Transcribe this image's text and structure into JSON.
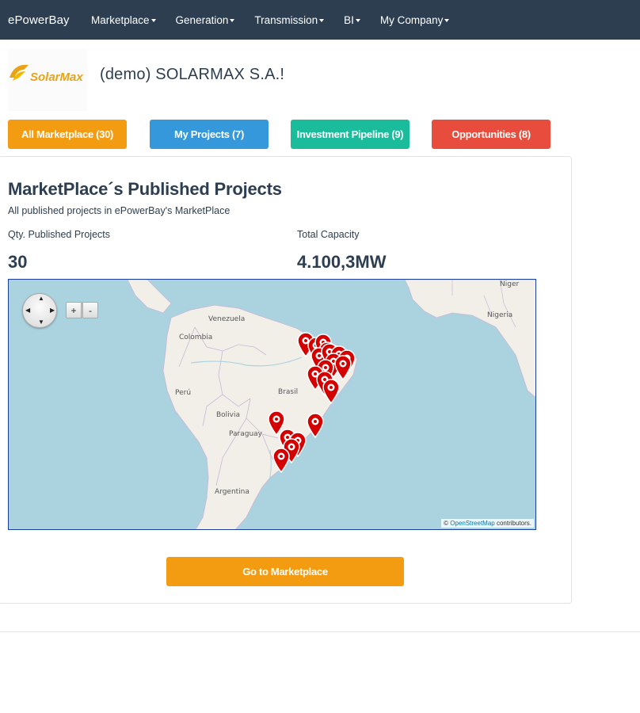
{
  "navbar": {
    "brand": "ePowerBay",
    "items": [
      "Marketplace",
      "Generation",
      "Transmission",
      "BI",
      "My Company"
    ]
  },
  "company": {
    "logo_text": "SolarMax",
    "name": "(demo) SOLARMAX S.A.!"
  },
  "filters": {
    "all": "All Marketplace (30)",
    "mine": "My Projects (7)",
    "pipeline": "Investment Pipeline (9)",
    "opportunities": "Opportunities (8)"
  },
  "panel": {
    "title": "MarketPlace´s Published Projects",
    "subtitle": "All published projects in ePowerBay's MarketPlace",
    "qty_label": "Qty. Published Projects",
    "qty_value": "30",
    "capacity_label": "Total Capacity",
    "capacity_value": "4.100,3MW"
  },
  "map": {
    "zoom_in": "+",
    "zoom_out": "-",
    "attribution_prefix": "© ",
    "attribution_link": "OpenStreetMap",
    "attribution_suffix": " contributors.",
    "labels": [
      "Niger",
      "Nigeria",
      "Venezuela",
      "Colombia",
      "Perú",
      "Brasil",
      "Bolivia",
      "Paraguay",
      "Argentina"
    ]
  },
  "go_button": "Go to Marketplace",
  "colors": {
    "navbar": "#2c3e50",
    "orange": "#f39c12",
    "blue": "#3498db",
    "teal": "#1abc9c",
    "red": "#e74c3c",
    "marker": "#d40000",
    "water": "#aad3df",
    "land": "#f2efe9"
  }
}
